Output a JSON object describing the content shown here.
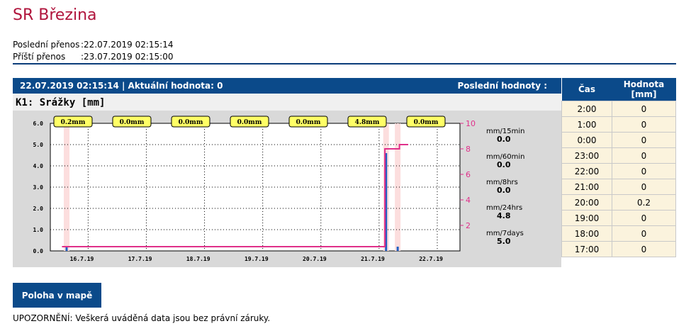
{
  "page": {
    "title": "SR Březina",
    "last_transfer_label": "Poslední přenos",
    "last_transfer_value": ":22.07.2019 02:15:14",
    "next_transfer_label": "Příští přenos",
    "next_transfer_value": ":23.07.2019 02:15:00"
  },
  "panel": {
    "header_left": "22.07.2019 02:15:14 | Aktuální hodnota: 0",
    "header_right": "Poslední hodnoty :",
    "chart_title": "K1: Srážky [mm]"
  },
  "chart_data": {
    "type": "bar",
    "x_labels": [
      "16.7.19",
      "17.7.19",
      "18.7.19",
      "19.7.19",
      "20.7.19",
      "21.7.19",
      "22.7.19"
    ],
    "ylim": [
      0,
      6
    ],
    "y_ticks": [
      "0.0",
      "1.0",
      "2.0",
      "3.0",
      "4.0",
      "5.0",
      "6.0"
    ],
    "y2lim": [
      0,
      10
    ],
    "y2_ticks": [
      "2",
      "4",
      "6",
      "8",
      "10"
    ],
    "daily_badges": [
      "0.2mm",
      "0.0mm",
      "0.0mm",
      "0.0mm",
      "0.0mm",
      "4.8mm",
      "0.0mm"
    ],
    "series": [
      {
        "name": "rain",
        "points": [
          [
            15.98,
            0.2
          ],
          [
            21.47,
            4.6
          ],
          [
            21.67,
            0.2
          ]
        ]
      },
      {
        "name": "cumulative",
        "step_points": [
          [
            15.9,
            0.2
          ],
          [
            21.45,
            0.2
          ],
          [
            21.45,
            4.8
          ],
          [
            21.7,
            4.8
          ],
          [
            21.7,
            5.0
          ],
          [
            21.85,
            5.0
          ]
        ]
      }
    ],
    "stats": [
      {
        "label": "mm/15min",
        "value": "0.0"
      },
      {
        "label": "mm/60min",
        "value": "0.0"
      },
      {
        "label": "mm/8hrs",
        "value": "0.0"
      },
      {
        "label": "mm/24hrs",
        "value": "4.8"
      },
      {
        "label": "mm/7days",
        "value": "5.0"
      }
    ],
    "colors": {
      "bar": "#1f5fc2",
      "cumulative": "#e0308a",
      "highlight": "#fcdede",
      "badge": "#ffff66",
      "plot_bg": "#ffffff",
      "panel_bg": "#d9d9d9"
    }
  },
  "table": {
    "col_time": "Čas",
    "col_value": "Hodnota [mm]",
    "rows": [
      {
        "time": "2:00",
        "value": "0"
      },
      {
        "time": "1:00",
        "value": "0"
      },
      {
        "time": "0:00",
        "value": "0"
      },
      {
        "time": "23:00",
        "value": "0"
      },
      {
        "time": "22:00",
        "value": "0"
      },
      {
        "time": "21:00",
        "value": "0"
      },
      {
        "time": "20:00",
        "value": "0.2"
      },
      {
        "time": "19:00",
        "value": "0"
      },
      {
        "time": "18:00",
        "value": "0"
      },
      {
        "time": "17:00",
        "value": "0"
      }
    ]
  },
  "actions": {
    "map_button": "Poloha v mapě"
  },
  "footer": {
    "notice": "UPOZORNĚNÍ: Veškerá uváděná data jsou bez právní záruky."
  }
}
